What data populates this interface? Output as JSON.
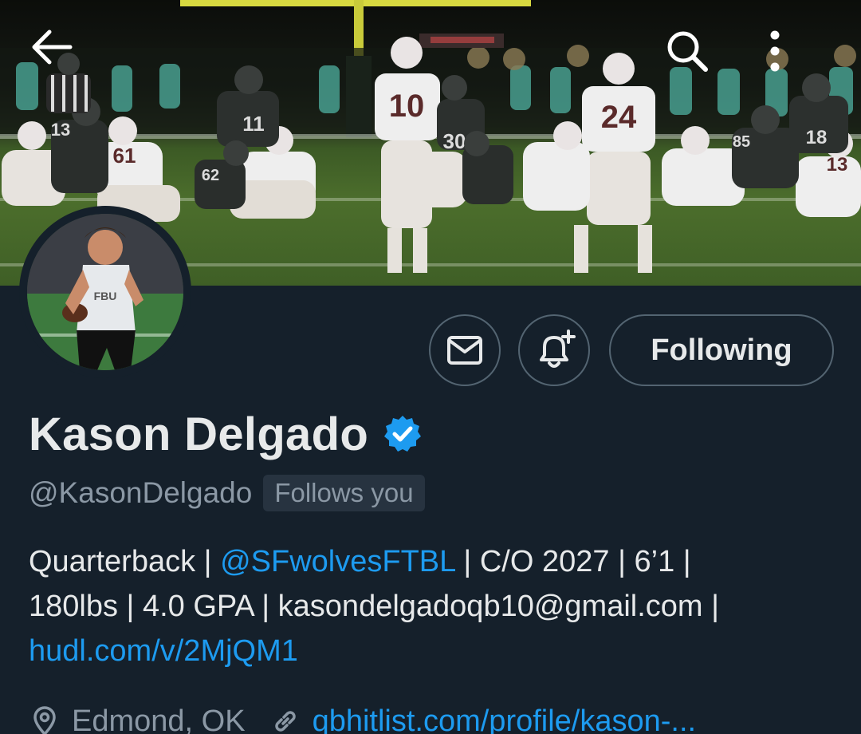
{
  "profile": {
    "display_name": "Kason Delgado",
    "verified_icon": "verified-badge-icon",
    "handle": "@KasonDelgado",
    "follows_you": "Follows you",
    "bio": {
      "line1_a": "Quarterback | ",
      "line1_link": "@SFwolvesFTBL",
      "line1_b": " | C/O 2027 | 6’1 |",
      "line2": "180lbs | 4.0 GPA | kasondelgadoqb10@gmail.com |",
      "line3_link": "hudl.com/v/2MjQM1"
    },
    "location": "Edmond, OK",
    "website": "qbhitlist.com/profile/kason-..."
  },
  "actions": {
    "following_label": "Following"
  },
  "banner": {
    "jersey_numbers": [
      "10",
      "24",
      "30",
      "11",
      "13",
      "61",
      "62",
      "85",
      "18",
      "13"
    ]
  },
  "colors": {
    "background": "#15202b",
    "accent": "#1d9bf0",
    "secondary_text": "#8b98a5",
    "border": "#536471"
  }
}
